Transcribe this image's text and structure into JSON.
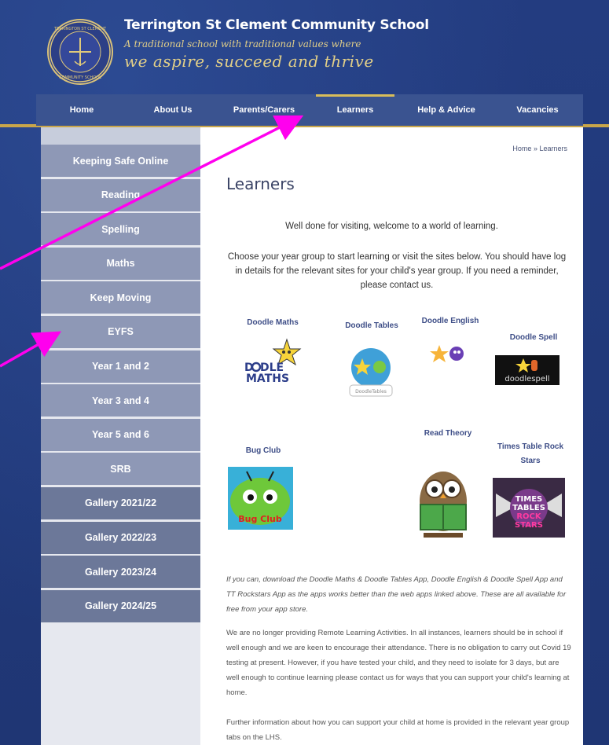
{
  "header": {
    "school_name": "Terrington St Clement Community School",
    "tagline_line1": "A traditional school with traditional values where",
    "tagline_line2": "we aspire, succeed and thrive",
    "crest_text_top": "TERRINGTON ST CLEMENT",
    "crest_text_bottom": "COMMUNITY SCHOOL"
  },
  "nav": {
    "items": [
      "Home",
      "About Us",
      "Parents/Carers",
      "Learners",
      "Help & Advice",
      "Vacancies"
    ],
    "active": "Learners"
  },
  "sidebar": {
    "items": [
      "Keeping Safe Online",
      "Reading",
      "Spelling",
      "Maths",
      "Keep Moving",
      "EYFS",
      "Year 1 and 2",
      "Year 3 and 4",
      "Year 5 and 6",
      "SRB",
      "Gallery 2021/22",
      "Gallery 2022/23",
      "Gallery 2023/24",
      "Gallery 2024/25"
    ]
  },
  "breadcrumb": {
    "home": "Home",
    "sep": "»",
    "current": "Learners"
  },
  "main": {
    "title": "Learners",
    "welcome": "Well done for visiting, welcome to a world of learning.",
    "intro": "Choose your year group to start learning or visit the sites below.  You should have log in details for the relevant sites for your child's year group.  If you need a reminder, please contact us.",
    "apps": {
      "doodle_maths": "Doodle Maths",
      "doodle_tables": "Doodle Tables",
      "doodle_english": "Doodle English",
      "doodle_spell": "Doodle Spell",
      "bug_club": "Bug Club",
      "read_theory": "Read Theory",
      "ttrs": "Times Table Rock Stars"
    },
    "logo_text": {
      "doodle_maths": "DOODLE MATHS",
      "doodle_tables": "DoodleTables",
      "doodle_spell": "doodlespell",
      "bug_club": "Bug Club",
      "ttrs": "TIMES TABLES ROCK STARS"
    },
    "note_italic": "If you can, download the Doodle Maths & Doodle Tables App, Doodle English & Doodle Spell App and TT Rockstars App as the apps works better than the web apps linked above.  These are all available for free from your app store.",
    "note_1": "We are no longer providing Remote Learning Activities.  In all instances, learners should be in school if well enough and we are keen to encourage their attendance.  There is no obligation to carry out Covid 19 testing at present.  However, if you have tested your child, and they need to isolate for 3 days, but are well enough to continue learning please contact us for ways that you can support your child's learning at home.",
    "note_2": "Further information about how you can support your child at home is provided in the relevant year group tabs on the LHS."
  },
  "colors": {
    "background": "#223a7a",
    "nav": "#3a5390",
    "gold": "#c9a64a",
    "sidebar_item": "#8e98b6",
    "annotation_arrow": "#ff00ee"
  }
}
